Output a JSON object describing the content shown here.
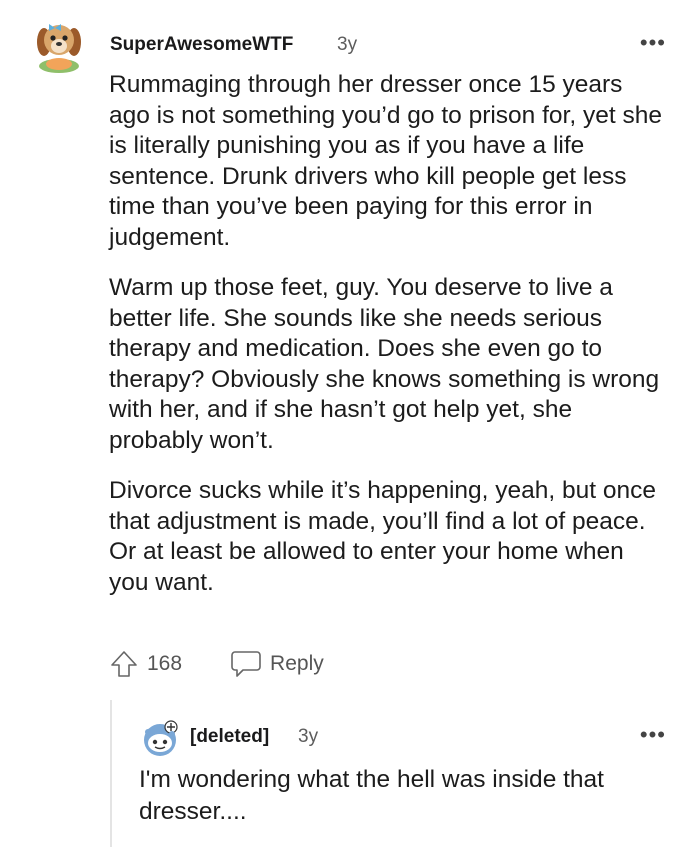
{
  "comment": {
    "author": "SuperAwesomeWTF",
    "age": "3y",
    "more_glyph": "•••",
    "paragraphs": [
      "Rummaging through her dresser once 15 years ago is not something you’d go to prison for, yet she is literally punishing you as if you have a life sentence. Drunk drivers who kill people get less time than you’ve been paying for this error in judgement.",
      "Warm up those feet, guy. You deserve to live a better life. She sounds like she needs serious therapy and medication. Does she even go to therapy? Obviously she knows something is wrong with her, and if she hasn’t got help yet, she probably won’t.",
      "Divorce sucks while it’s happening, yeah, but once that adjustment is made, you’ll find a lot of peace. Or at least be allowed to enter your home when you want."
    ],
    "upvotes": "168",
    "reply_label": "Reply",
    "avatar_icon": "dog-avatar-icon"
  },
  "reply": {
    "author": "[deleted]",
    "age": "3y",
    "more_glyph": "•••",
    "text": "I'm wondering what the hell was inside that dresser....",
    "avatar_icon": "snoo-avatar-icon"
  },
  "colors": {
    "text": "#1c1c1c",
    "meta": "#5d5d5d",
    "thread_line": "#e4e4e4"
  }
}
